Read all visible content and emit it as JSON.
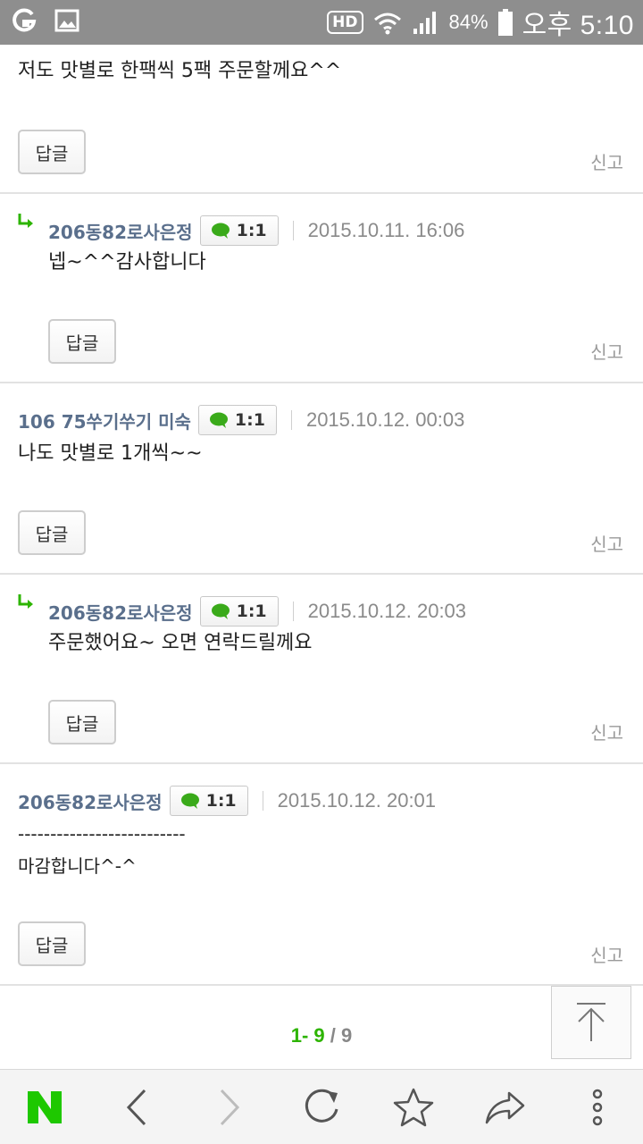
{
  "status_bar": {
    "hd": "HD",
    "battery": "84%",
    "time": "오후 5:10"
  },
  "comments": [
    {
      "author": "",
      "chat_label": "",
      "date": "",
      "body": "저도 맛별로 한팩씩 5팩 주문할께요^^",
      "reply_label": "답글",
      "report_label": "신고",
      "is_reply": false
    },
    {
      "author": "206동82로사은정",
      "chat_label": "1:1",
      "date": "2015.10.11. 16:06",
      "body": "넵~^^감사합니다",
      "reply_label": "답글",
      "report_label": "신고",
      "is_reply": true
    },
    {
      "author": "106 75쑤기쑤기 미숙",
      "chat_label": "1:1",
      "date": "2015.10.12. 00:03",
      "body": "나도 맛별로 1개씩~~",
      "reply_label": "답글",
      "report_label": "신고",
      "is_reply": false
    },
    {
      "author": "206동82로사은정",
      "chat_label": "1:1",
      "date": "2015.10.12. 20:03",
      "body": "주문했어요~ 오면 연락드릴께요",
      "reply_label": "답글",
      "report_label": "신고",
      "is_reply": true
    },
    {
      "author": "206동82로사은정",
      "chat_label": "1:1",
      "date": "2015.10.12. 20:01",
      "body": "--------------------------\n마감합니다^-^",
      "reply_label": "답글",
      "report_label": "신고",
      "is_reply": false
    }
  ],
  "pagination": {
    "current": "1- 9",
    "total": "/ 9"
  },
  "colors": {
    "accent_green": "#2db400",
    "author_blue": "#5a6f8c",
    "status_bar": "#8e8e8e"
  },
  "bottom_bar": {
    "items": [
      "naver-home-icon",
      "back-icon",
      "forward-icon",
      "refresh-icon",
      "bookmark-star-icon",
      "share-icon",
      "more-icon"
    ]
  }
}
